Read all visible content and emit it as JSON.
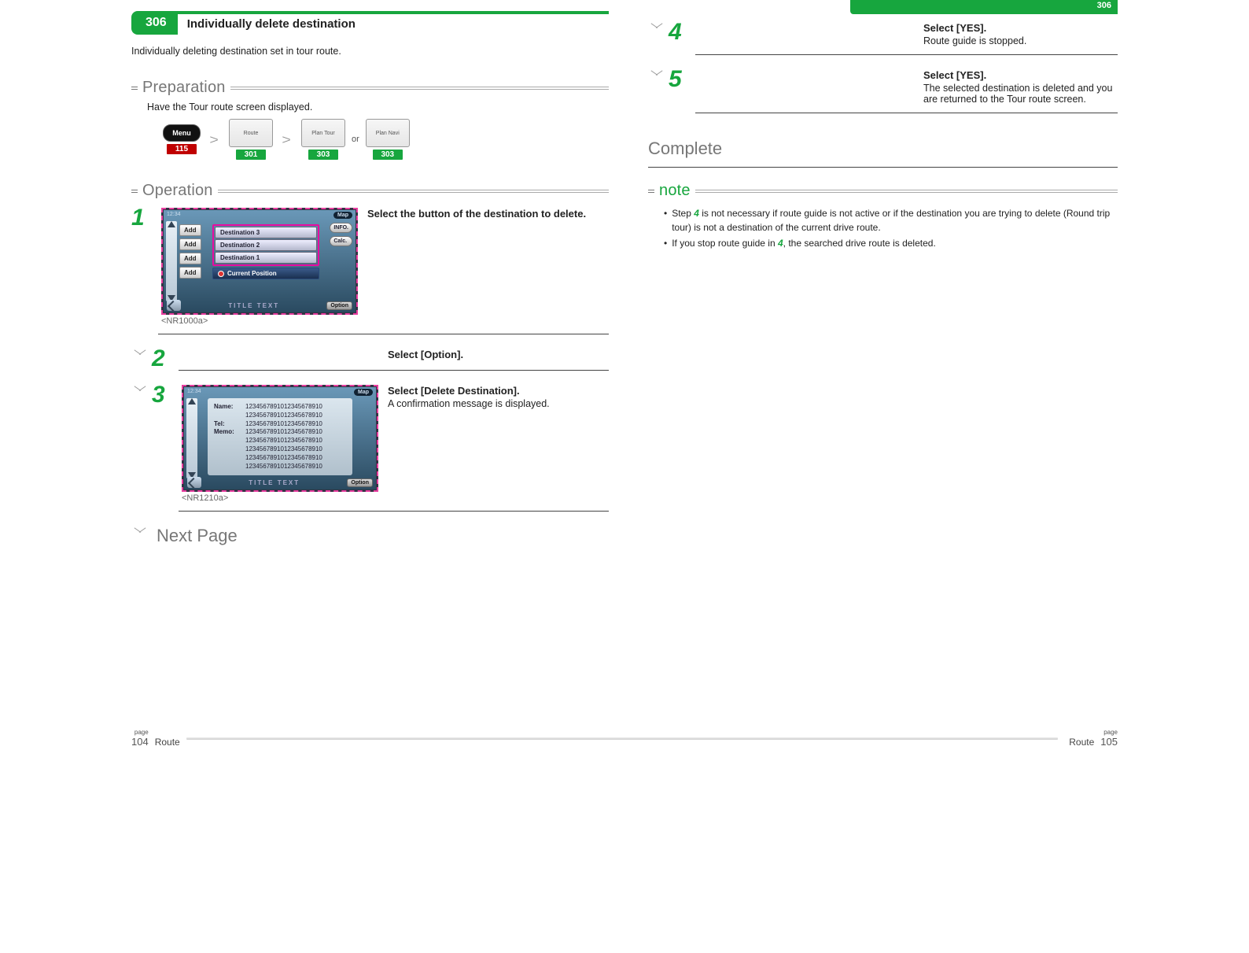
{
  "header": {
    "section_number": "306",
    "title": "Individually delete destination",
    "right_tab": "306"
  },
  "intro": "Individually deleting destination set in tour route.",
  "preparation": {
    "label": "Preparation",
    "text": "Have the Tour route screen displayed.",
    "items": [
      {
        "img_label": "Menu",
        "ref": "115",
        "ref_color": "red"
      },
      {
        "img_label": "Route",
        "ref": "301",
        "ref_color": "green"
      },
      {
        "img_label": "Plan Tour",
        "ref": "303",
        "ref_color": "green"
      },
      {
        "img_label": "Plan Navi",
        "ref": "303",
        "ref_color": "green"
      }
    ],
    "or": "or"
  },
  "operation_label": "Operation",
  "steps_left": [
    {
      "num": "1",
      "bold": "Select the button of the destination to delete.",
      "sub": "",
      "shot_ref": "<NR1000a>",
      "screenshot": "tour"
    },
    {
      "num": "2",
      "bold": "Select [Option].",
      "sub": "",
      "shot_ref": "",
      "screenshot": null
    },
    {
      "num": "3",
      "bold": "Select [Delete Destination].",
      "sub": "A confirmation message is displayed.",
      "shot_ref": "<NR1210a>",
      "screenshot": "info"
    }
  ],
  "next_page": "Next Page",
  "steps_right": [
    {
      "num": "4",
      "bold": "Select [YES].",
      "sub": "Route guide is stopped."
    },
    {
      "num": "5",
      "bold": "Select [YES].",
      "sub": "The selected destination is deleted and you are returned to the Tour route screen."
    }
  ],
  "complete": "Complete",
  "note": {
    "label": "note",
    "items": [
      {
        "pre": "Step ",
        "ref": "4",
        "post": " is not necessary if route guide is not active or if the destination you are trying to delete (Round trip tour) is not a destination of the current drive route."
      },
      {
        "pre": "If you stop route guide in ",
        "ref": "4",
        "post": ", the searched drive route is deleted."
      }
    ]
  },
  "screenshot_tour": {
    "time": "12:34",
    "map_label": "Map",
    "add": "Add",
    "destinations": [
      "Destination 3",
      "Destination 2",
      "Destination 1"
    ],
    "current": "Current Position",
    "info": "INFO.",
    "calc": "Calc.",
    "title": "TITLE TEXT",
    "option": "Option"
  },
  "screenshot_info": {
    "time": "12:34",
    "map_label": "Map",
    "name_label": "Name:",
    "tel_label": "Tel:",
    "memo_label": "Memo:",
    "long_value": "12345678910123456789​10",
    "title": "TITLE TEXT",
    "option": "Option"
  },
  "footer": {
    "page_label": "page",
    "left_num": "104",
    "right_num": "105",
    "section": "Route"
  }
}
